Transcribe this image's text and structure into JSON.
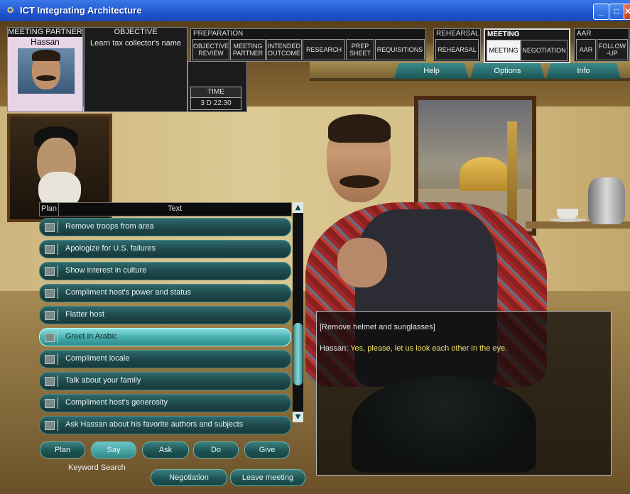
{
  "window": {
    "title": "ICT Integrating Architecture",
    "controls": [
      "_",
      "□",
      "✕"
    ]
  },
  "meeting_partner": {
    "header": "MEETING PARTNER",
    "name": "Hassan"
  },
  "objective": {
    "header": "OBJECTIVE",
    "text": "Learn tax collector's name"
  },
  "time": {
    "header": "TIME",
    "value": "3 D 22:30"
  },
  "nav": {
    "preparation": {
      "header": "PREPARATION",
      "items": [
        "OBJECTIVE REVIEW",
        "MEETING PARTNER",
        "INTENDED OUTCOME",
        "RESEARCH",
        "PREP SHEET",
        "REQUISITIONS"
      ]
    },
    "rehearsal": {
      "header": "REHEARSAL",
      "items": [
        "REHEARSAL"
      ]
    },
    "meeting": {
      "header": "MEETING",
      "items": [
        "MEETING",
        "NEGOTIATION"
      ],
      "active": "MEETING"
    },
    "aar": {
      "header": "AAR",
      "items": [
        "AAR",
        "FOLLOW -UP"
      ]
    }
  },
  "tabs": [
    "Help",
    "Options",
    "Info"
  ],
  "action_list": {
    "columns": [
      "Plan",
      "Text"
    ],
    "items": [
      "Remove troops from area",
      "Apologize for U.S. failures",
      "Show interest in culture",
      "Compliment host's power and status",
      "Flatter host",
      "Greet in Arabic",
      "Compliment locale",
      "Talk about your family",
      "Compliment host's generosity",
      "Ask Hassan about his favorite authors and subjects"
    ],
    "selected_index": 5,
    "scroll_up": "▲",
    "scroll_down": "▼"
  },
  "action_buttons": [
    "Plan",
    "Say",
    "Ask",
    "Do",
    "Give"
  ],
  "selected_action_button": "Say",
  "keyword_search": "Keyword Search",
  "bottom_buttons": [
    "Negotiation",
    "Leave meeting"
  ],
  "dialog": {
    "line1": "[Remove helmet and sunglasses]",
    "speaker": "Hassan:",
    "speech": "Yes, please, let us look each other in the eye."
  },
  "colors": {
    "titlebar": "#1f55d0",
    "button_teal": "#1e5454",
    "speech_yellow": "#f0e060",
    "selected_row": "#4ab0b0"
  }
}
